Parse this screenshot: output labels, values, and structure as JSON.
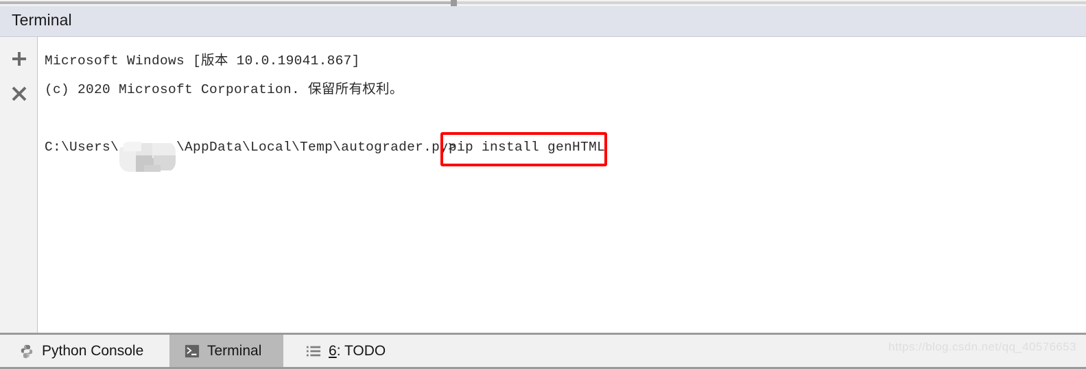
{
  "window": {
    "tool_title": "Terminal"
  },
  "side_rail": {
    "add_label": "+",
    "close_label": "×",
    "add_icon": "plus-icon",
    "close_icon": "close-icon"
  },
  "terminal": {
    "lines": [
      "Microsoft Windows [版本 10.0.19041.867]",
      "(c) 2020 Microsoft Corporation. 保留所有权利。"
    ],
    "prompt_prefix": "C:\\Users\\",
    "prompt_suffix": "\\AppData\\Local\\Temp\\autograder.py>",
    "redacted_username": "",
    "command": "pip install genHTML",
    "highlight_color": "#fe0000"
  },
  "tabs": [
    {
      "label": "Python Console",
      "icon": "python-icon",
      "active": false
    },
    {
      "label": "Terminal",
      "icon": "terminal-icon",
      "active": true
    },
    {
      "label": "6: TODO",
      "icon": "todo-list-icon",
      "active": false,
      "mnemonic": "6"
    }
  ],
  "watermark": {
    "text": "https://blog.csdn.net/qq_40576653"
  }
}
